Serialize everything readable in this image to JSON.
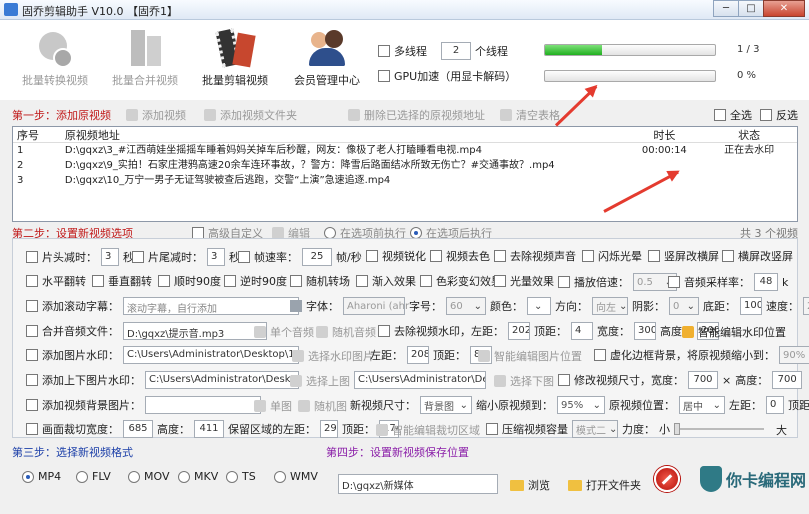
{
  "window": {
    "title": "固乔剪辑助手 V10.0  【固乔1】",
    "controls": {
      "min": "─",
      "max": "□",
      "close": "✕"
    }
  },
  "toolbar": [
    {
      "label": "批量转换视频",
      "icon": "swap-icon",
      "enabled": false
    },
    {
      "label": "批量合并视频",
      "icon": "merge-icon",
      "enabled": false
    },
    {
      "label": "批量剪辑视频",
      "icon": "film-icon",
      "enabled": true
    },
    {
      "label": "会员管理中心",
      "icon": "user-icon",
      "enabled": true
    }
  ],
  "threads": {
    "checkbox_label": "多线程",
    "value": "2",
    "suffix": "个线程"
  },
  "gpu": {
    "label": "GPU加速（用显卡解码）"
  },
  "progress": [
    {
      "text": "1 / 3",
      "fraction": 0.333
    },
    {
      "text": "0 %",
      "fraction": 0
    }
  ],
  "step1": {
    "title": "第一步：添加原视频",
    "actions": [
      "添加视频",
      "添加视频文件夹",
      "删除已选择的原视频地址",
      "清空表格"
    ],
    "select_all": "全选",
    "invert": "反选"
  },
  "table": {
    "headers": [
      "序号",
      "原视频地址",
      "时长",
      "状态"
    ],
    "rows": [
      [
        "1",
        "D:\\gqxz\\3_#江西萌娃坐摇摇车睡着妈妈关掉车后秒醒，网友：像极了老人打瞌睡看电视.mp4",
        "00:00:14",
        "正在去水印"
      ],
      [
        "2",
        "D:\\gqxz\\9_实拍！石家庄港鸦高速20余车连环事故，？警方：降雪后路面结冰所致无伤亡？#交通事故？.mp4",
        "",
        ""
      ],
      [
        "3",
        "D:\\gqxz\\10_万宁一男子无证驾驶被查后逃跑，交警“上演”急速追逐.mp4",
        "",
        ""
      ]
    ]
  },
  "step2": {
    "title": "第二步：设置新视频选项",
    "advanced": "高级自定义",
    "edit": "编辑",
    "before": "在选项前执行",
    "after": "在选项后执行",
    "count": "共 3 个视频"
  },
  "row1": {
    "head_cut": "片头减时：",
    "head_val": "3",
    "sec": "秒",
    "tail_cut": "片尾减时：",
    "tail_val": "3",
    "fps": "帧速率：",
    "fps_val": "25",
    "fps_unit": "帧/秒",
    "sharpen": "视频锐化",
    "decolor": "视频去色",
    "mute": "去除视频声音",
    "flash": "闪烁光晕",
    "vscreen": "竖屏改横屏",
    "hscreen": "横屏改竖屏"
  },
  "row2": {
    "hflip": "水平翻转",
    "vflip": "垂直翻转",
    "cw90": "顺时90度",
    "ccw90": "逆时90度",
    "random_trans": "随机转场",
    "fadein": "渐入效果",
    "color_shift": "色彩变幻效果",
    "light": "光量效果",
    "speed": "播放倍速：",
    "speed_val": "0.5",
    "samplerate": "音频采样率：",
    "samplerate_val": "48",
    "k": "k"
  },
  "row3": {
    "scroll": "添加滚动字幕：",
    "scroll_ph": "滚动字幕，自行添加",
    "font": "字体：",
    "font_val": "Aharoni (ahr",
    "size": "字号：",
    "size_val": "60",
    "color": "颜色：",
    "dir": "方向：",
    "dir_val": "向左",
    "shadow": "阴影：",
    "shadow_val": "0",
    "bottom": "底距：",
    "bottom_val": "100",
    "speed": "速度：",
    "speed_val": "2"
  },
  "row4": {
    "audio": "合并音频文件：",
    "audio_val": "D:\\gqxz\\提示音.mp3",
    "single": "单个音频",
    "random": "随机音频",
    "wm": "去除视频水印，左距：",
    "left": "202",
    "top_l": "顶距：",
    "top": "4",
    "w_l": "宽度：",
    "w": "300",
    "h_l": "高度：",
    "h": "200",
    "smart": "智能编辑水印位置"
  },
  "row5": {
    "imgwm": "添加图片水印：",
    "imgwm_val": "C:\\Users\\Administrator\\Desktop\\111.j",
    "choose": "选择水印图片",
    "left_l": "左距：",
    "left": "208",
    "top_l": "顶距：",
    "top": "85",
    "smart": "智能编辑图片位置",
    "blur": "虚化边框背景，将原视频缩小到：",
    "blur_val": "90%"
  },
  "row6": {
    "ud": "添加上下图片水印：",
    "up_val": "C:\\Users\\Administrator\\Desktop\\i",
    "up": "选择上图",
    "down_val": "C:\\Users\\Administrator\\Desk",
    "down": "选择下图",
    "resize": "修改视频尺寸，宽度：",
    "w": "700",
    "x": "×",
    "h_l": "高度：",
    "h": "700"
  },
  "row7": {
    "bg": "添加视频背景图片：",
    "single": "单图",
    "random": "随机图",
    "newsize": "新视频尺寸：",
    "newsize_val": "背景图",
    "shrink": "缩小原视频到：",
    "shrink_val": "95%",
    "pos": "原视频位置：",
    "pos_val": "居中",
    "left_l": "左距：",
    "left": "0",
    "top_l": "顶距：",
    "top": "0"
  },
  "row8": {
    "crop": "画面裁切宽度：",
    "crop_w": "685",
    "h_l": "高度：",
    "crop_h": "411",
    "keep": "保留区域的左距：",
    "left": "29",
    "top_l": "顶距：",
    "top": "174",
    "smart": "智能编辑裁切区域",
    "compress": "压缩视频容量",
    "mode": "模式二",
    "force": "力度：",
    "small": "小",
    "big": "大"
  },
  "step3": {
    "title": "第三步：选择新视频格式",
    "formats": [
      "MP4",
      "FLV",
      "MOV",
      "MKV",
      "TS",
      "WMV"
    ]
  },
  "step4": {
    "title": "第四步：设置新视频保存位置",
    "path": "D:\\gqxz\\新媒体",
    "browse": "浏览",
    "open": "打开文件夹"
  },
  "watermark": {
    "text": "你卡编程网"
  }
}
